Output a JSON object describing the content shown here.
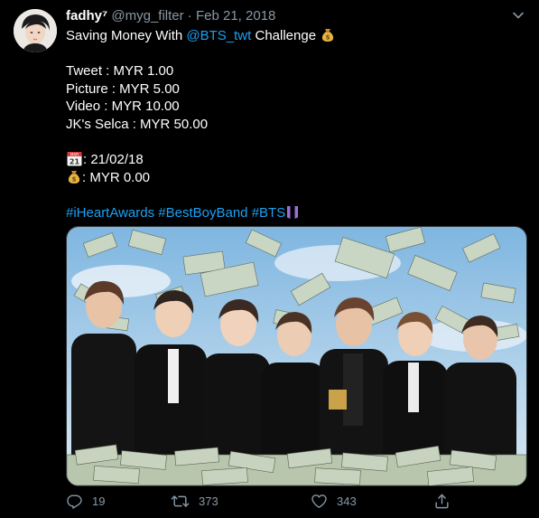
{
  "tweet": {
    "display_name": "fadhy⁷",
    "handle": "@myg_filter",
    "separator": "·",
    "date": "Feb 21, 2018",
    "text": {
      "line1_prefix": "Saving Money With ",
      "mention": "@BTS_twt",
      "line1_suffix": " Challenge",
      "rate_tweet": "Tweet : MYR 1.00",
      "rate_picture": "Picture : MYR 5.00",
      "rate_video": "Video : MYR 10.00",
      "rate_selca": "JK's Selca : MYR 50.00",
      "date_line": ": 21/02/18",
      "total_line": ": MYR 0.00",
      "hashtags": [
        "#iHeartAwards",
        "#BestBoyBand",
        "#BTS"
      ]
    },
    "icons": {
      "money_bag": "money-bag-icon",
      "calendar": "calendar-icon",
      "heart": "purple-heart-icon",
      "calendar_month": "MAR",
      "calendar_day": "21"
    },
    "actions": {
      "replies": "19",
      "retweets": "373",
      "likes": "343"
    },
    "colors": {
      "link": "#1da1f2",
      "muted": "#8899a6",
      "background": "#000000"
    }
  }
}
